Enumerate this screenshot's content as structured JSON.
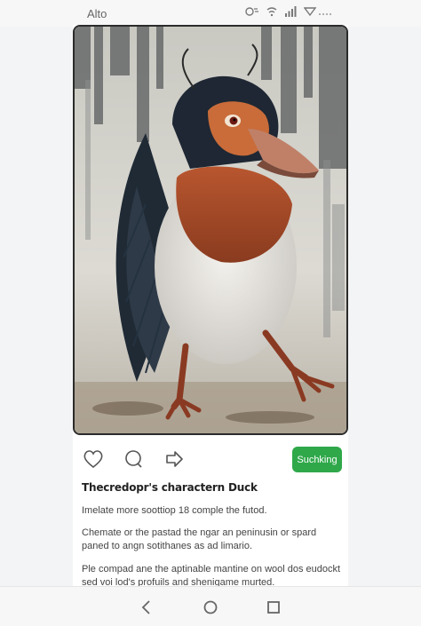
{
  "status_bar": {
    "time": "Alto",
    "icons": [
      "alarm-icon",
      "wifi-icon",
      "signal-icon",
      "battery-icon"
    ]
  },
  "post": {
    "image_subject": "duck-character-painting",
    "follow_label": "Suchking",
    "title": "Thecredopr's charactern Duck",
    "paragraph_1": "Imelate more soottiop 18 comple the futod.",
    "paragraph_2": "Chemate or the pastad the ngar an peninusin or spard paned to angn sotithanes as ad limario.",
    "paragraph_3": "Ple compad ane the aptinable mantine on wool dos eudockt sed voi lod's profuils and shenigame murted."
  },
  "actions": {
    "icons": [
      "heart-icon",
      "comment-icon",
      "share-icon"
    ]
  },
  "colors": {
    "accent": "#2fa84a",
    "background": "#f3f4f5"
  },
  "nav": {
    "icons": [
      "back-icon",
      "home-icon",
      "recents-icon"
    ]
  }
}
